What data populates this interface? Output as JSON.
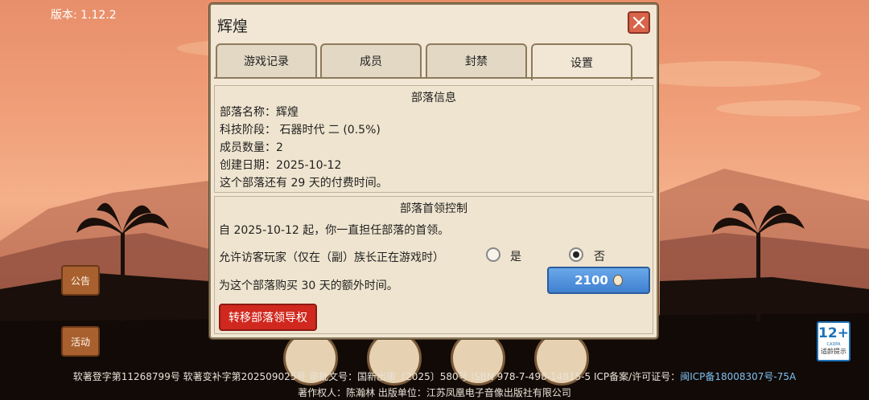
{
  "version": "版本: 1.12.2",
  "left_buttons": {
    "notice": "公告",
    "event": "活动"
  },
  "age_badge": {
    "rating": "12+",
    "org": "CADPA",
    "label": "适龄提示"
  },
  "footer": {
    "line1": "软著登字第11268799号 软著变补字第202509025号 审批文号：国新出审〔2025〕580号 ISBN 978-7-498-14815-5 ICP备案/许可证号：",
    "icp_link": "闽ICP备18008307号-75A",
    "line2": "著作权人：陈瀚林 出版单位：江苏凤凰电子音像出版社有限公司"
  },
  "dialog": {
    "title": "辉煌",
    "tabs": [
      {
        "label": "游戏记录"
      },
      {
        "label": "成员"
      },
      {
        "label": "封禁"
      },
      {
        "label": "设置"
      }
    ],
    "info": {
      "title": "部落信息",
      "name": "部落名称：辉煌",
      "tech": "科技阶段： 石器时代 二 (0.5%)",
      "members": "成员数量：2",
      "created": "创建日期：2025-10-12",
      "paid": "这个部落还有 29 天的付费时间。"
    },
    "leader": {
      "title": "部落首领控制",
      "since": "自 2025-10-12 起，你一直担任部落的首领。",
      "allow_visitors": "允许访客玩家（仅在（副）族长正在游戏时）",
      "yes": "是",
      "no": "否",
      "selected": "否",
      "buy_text": "为这个部落购买 30 天的额外时间。",
      "buy_price": "2100",
      "transfer": "转移部落领导权"
    }
  },
  "colors": {
    "buy_button": "#3f80d0",
    "transfer_button": "#d0281e",
    "close_button": "#d8644a"
  }
}
